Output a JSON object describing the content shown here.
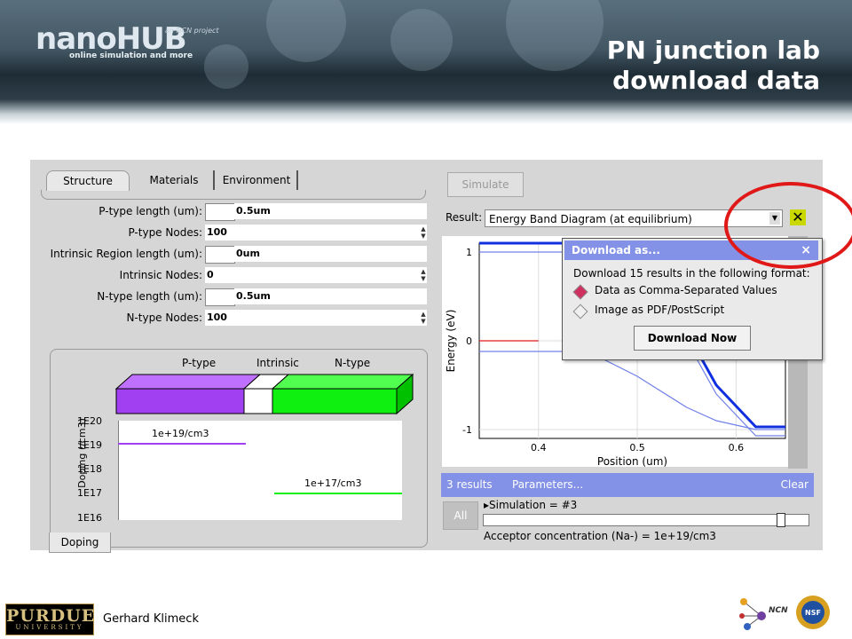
{
  "header": {
    "logo_text": "nanoHUB",
    "logo_tagline": "online simulation and more",
    "ncn_project": "an NCN project",
    "title_line1": "PN junction lab",
    "title_line2": "download data"
  },
  "tabs": [
    "Structure",
    "Materials",
    "Environment"
  ],
  "fields": [
    {
      "label": "P-type length (um):",
      "value": "0.5um",
      "box": true
    },
    {
      "label": "P-type Nodes:",
      "value": "100",
      "box": false
    },
    {
      "label": "Intrinsic Region length (um):",
      "value": "0um",
      "box": true
    },
    {
      "label": "Intrinsic Nodes:",
      "value": "0",
      "box": false
    },
    {
      "label": "N-type length (um):",
      "value": "0.5um",
      "box": true
    },
    {
      "label": "N-type Nodes:",
      "value": "100",
      "box": false
    }
  ],
  "doping_panel": {
    "regions": [
      "P-type",
      "Intrinsic",
      "N-type"
    ],
    "ylabel": "Doping (/cm3)",
    "ticks": [
      "1E20",
      "1E19",
      "1E18",
      "1E17",
      "1E16"
    ],
    "p_label": "1e+19/cm3",
    "n_label": "1e+17/cm3",
    "tab": "Doping",
    "colors": {
      "p": "#a040f0",
      "n": "#10f010"
    }
  },
  "simulate_button": "Simulate",
  "result": {
    "label": "Result:",
    "selected": "Energy Band Diagram (at equilibrium)"
  },
  "chart_data": {
    "type": "line",
    "xlabel": "Position (um)",
    "ylabel": "Energy (eV)",
    "xticks": [
      "0.4",
      "0.5",
      "0.6"
    ],
    "yticks": [
      "1",
      "0",
      "-1"
    ],
    "xlim": [
      0.34,
      0.65
    ],
    "ylim": [
      -1.1,
      1.1
    ],
    "series": [
      {
        "color": "#1030e0",
        "x": [
          0.34,
          0.45,
          0.5,
          0.55,
          0.58,
          0.62,
          0.65
        ],
        "y": [
          1.1,
          1.1,
          0.75,
          0.1,
          -0.5,
          -0.97,
          -0.97
        ]
      },
      {
        "color": "#7080e8",
        "x": [
          0.34,
          0.45,
          0.5,
          0.55,
          0.58,
          0.62,
          0.65
        ],
        "y": [
          1.0,
          1.0,
          0.65,
          0.0,
          -0.6,
          -1.07,
          -1.07
        ]
      },
      {
        "color": "#7080e8",
        "x": [
          0.34,
          0.45,
          0.5,
          0.55,
          0.58,
          0.62,
          0.65
        ],
        "y": [
          -0.12,
          -0.12,
          -0.4,
          -0.75,
          -0.9,
          -1.0,
          -1.0
        ]
      },
      {
        "color": "#e01818",
        "x": [
          0.34,
          0.4
        ],
        "y": [
          0.0,
          0.0
        ]
      }
    ]
  },
  "download_popup": {
    "title": "Download as...",
    "close": "×",
    "text": "Download 15 results in the following format:",
    "options": [
      "Data as Comma-Separated Values",
      "Image as PDF/PostScript"
    ],
    "button": "Download Now"
  },
  "results_bar": {
    "count": "3 results",
    "params": "Parameters...",
    "clear": "Clear"
  },
  "all_button": "All",
  "simulation_label": "▸Simulation = #3",
  "acceptor_label": "Acceptor concentration (Na-) = 1e+19/cm3",
  "footer": {
    "purdue": "PURDUE",
    "purdue_sub": "UNIVERSITY",
    "author": "Gerhard Klimeck",
    "ncn": "NCN"
  }
}
